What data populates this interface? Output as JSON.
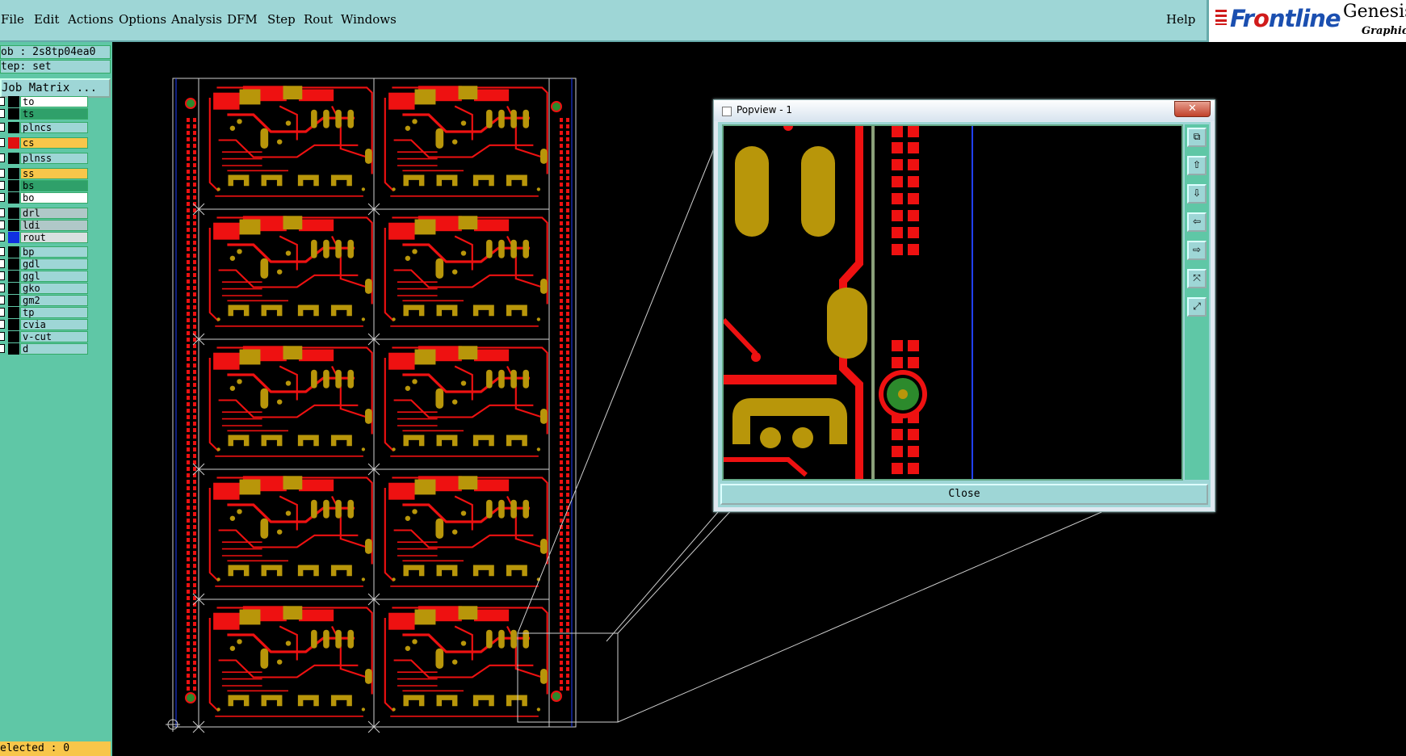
{
  "menu": {
    "items": [
      "File",
      "Edit",
      "Actions",
      "Options",
      "Analysis",
      "DFM",
      "Step",
      "Rout",
      "Windows"
    ],
    "help": "Help"
  },
  "brand": {
    "name_pre": "Fr",
    "name_o": "o",
    "name_post": "ntline",
    "product": "Genesis",
    "subtitle": "Graphic E"
  },
  "left_panel": {
    "job": "ob : 2s8tp04ea0",
    "step": "tep: set",
    "job_matrix_button": "Job Matrix ...",
    "layers": [
      {
        "name": "to",
        "swatch": "#000000",
        "bg": "#ffffff"
      },
      {
        "name": "ts",
        "swatch": "#000000",
        "bg": "#2fa06a"
      },
      {
        "name": "plncs",
        "swatch": "#000000",
        "bg": "#9ed6d6"
      },
      {
        "name": "cs",
        "swatch": "#e01010",
        "bg": "#f8c64a"
      },
      {
        "name": "plnss",
        "swatch": "#000000",
        "bg": "#9ed6d6"
      },
      {
        "name": "ss",
        "swatch": "#000000",
        "bg": "#f8c64a"
      },
      {
        "name": "bs",
        "swatch": "#000000",
        "bg": "#2fa06a"
      },
      {
        "name": "bo",
        "swatch": "#000000",
        "bg": "#ffffff"
      },
      {
        "name": "drl",
        "swatch": "#000000",
        "bg": "#b0c8c8"
      },
      {
        "name": "ldi",
        "swatch": "#000000",
        "bg": "#b0c8c8"
      },
      {
        "name": "rout",
        "swatch": "#1030e0",
        "bg": "#d8e0e0"
      },
      {
        "name": "bp",
        "swatch": "#000000",
        "bg": "#9ed6d6"
      },
      {
        "name": "gdl",
        "swatch": "#000000",
        "bg": "#9ed6d6"
      },
      {
        "name": "ggl",
        "swatch": "#000000",
        "bg": "#9ed6d6"
      },
      {
        "name": "gko",
        "swatch": "#000000",
        "bg": "#9ed6d6"
      },
      {
        "name": "gm2",
        "swatch": "#000000",
        "bg": "#9ed6d6"
      },
      {
        "name": "tp",
        "swatch": "#000000",
        "bg": "#9ed6d6"
      },
      {
        "name": "cvia",
        "swatch": "#000000",
        "bg": "#9ed6d6"
      },
      {
        "name": "v-cut",
        "swatch": "#000000",
        "bg": "#9ed6d6"
      },
      {
        "name": "d",
        "swatch": "#000000",
        "bg": "#9ed6d6"
      }
    ],
    "selected": "elected : 0"
  },
  "popview": {
    "title": "Popview - 1",
    "close_x": "✕",
    "close_button": "Close",
    "tool_icons": [
      "zoom-fit-icon",
      "move-up-icon",
      "move-down-icon",
      "move-left-icon",
      "move-right-icon",
      "zoom-out-icon",
      "zoom-in-icon"
    ]
  },
  "colors": {
    "copper": "#ee1111",
    "pad": "#b8960a",
    "via": "#2c8a2c",
    "outline": "#cfcfcf",
    "rout": "#2040ff"
  }
}
